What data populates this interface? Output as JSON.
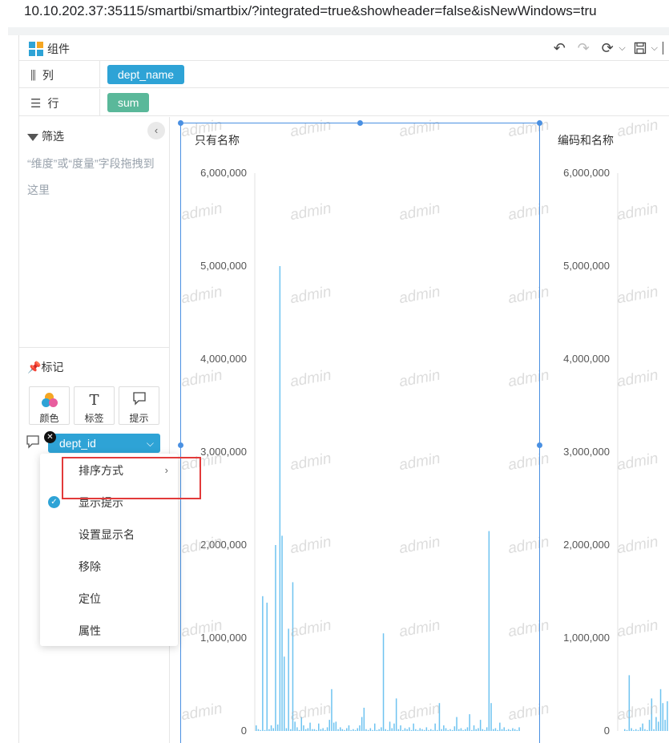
{
  "browser": {
    "url": "10.10.202.37:35115/smartbi/smartbix/?integrated=true&showheader=false&isNewWindows=tru"
  },
  "toolbar": {
    "title": "组件"
  },
  "shelves": {
    "columns": {
      "label": "列",
      "pill": "dept_name"
    },
    "rows": {
      "label": "行",
      "pill": "sum"
    }
  },
  "filter": {
    "title": "筛选",
    "hint": "“维度”或“度量”字段拖拽到这里"
  },
  "marks": {
    "title": "标记",
    "buttons": [
      {
        "label": "颜色",
        "icon": "palette-icon"
      },
      {
        "label": "标签",
        "icon": "text-t-icon",
        "glyph": "T"
      },
      {
        "label": "提示",
        "icon": "tooltip-icon",
        "glyph": "🗨"
      }
    ],
    "field_pill": "dept_id"
  },
  "context_menu": {
    "items": [
      {
        "label": "排序方式",
        "submenu": true,
        "checked": false
      },
      {
        "label": "显示提示",
        "submenu": false,
        "checked": true
      },
      {
        "label": "设置显示名",
        "submenu": false,
        "checked": false
      },
      {
        "label": "移除",
        "submenu": false,
        "checked": false
      },
      {
        "label": "定位",
        "submenu": false,
        "checked": false
      },
      {
        "label": "属性",
        "submenu": false,
        "checked": false
      }
    ]
  },
  "watermark": "admin",
  "colors": {
    "accent": "#2ea3d6",
    "green_pill": "#5ab89a",
    "bar": "#6ec3f0",
    "selection": "#4a90e2",
    "highlight_box": "#e23a3a"
  },
  "chart_data": [
    {
      "type": "bar",
      "title": "只有名称",
      "ylim": [
        0,
        6000000
      ],
      "y_ticks": [
        "6,000,000",
        "5,000,000",
        "4,000,000",
        "3,000,000",
        "2,000,000",
        "1,000,000",
        "0"
      ],
      "values": [
        60000,
        20000,
        10000,
        1450000,
        10000,
        1380000,
        20000,
        60000,
        30000,
        2000000,
        70000,
        5000000,
        2100000,
        800000,
        30000,
        1100000,
        20000,
        1600000,
        100000,
        40000,
        10000,
        150000,
        60000,
        20000,
        30000,
        90000,
        20000,
        20000,
        10000,
        80000,
        20000,
        30000,
        10000,
        40000,
        120000,
        450000,
        90000,
        100000,
        20000,
        40000,
        20000,
        10000,
        30000,
        60000,
        10000,
        20000,
        10000,
        30000,
        60000,
        150000,
        250000,
        20000,
        10000,
        30000,
        10000,
        80000,
        10000,
        20000,
        40000,
        1050000,
        20000,
        10000,
        100000,
        30000,
        80000,
        350000,
        20000,
        60000,
        10000,
        30000,
        20000,
        40000,
        10000,
        80000,
        20000,
        10000,
        30000,
        20000,
        10000,
        40000,
        10000,
        20000,
        10000,
        80000,
        10000,
        300000,
        20000,
        60000,
        30000,
        10000,
        20000,
        10000,
        50000,
        150000,
        20000,
        30000,
        10000,
        20000,
        40000,
        180000,
        10000,
        60000,
        20000,
        30000,
        120000,
        20000,
        10000,
        40000,
        2150000,
        300000,
        20000,
        30000,
        10000,
        90000,
        20000,
        40000,
        10000,
        20000,
        10000,
        30000,
        20000,
        10000,
        40000
      ]
    },
    {
      "type": "bar",
      "title": "编码和名称",
      "ylim": [
        0,
        6000000
      ],
      "y_ticks": [
        "6,000,000",
        "5,000,000",
        "4,000,000",
        "3,000,000",
        "2,000,000",
        "1,000,000",
        "0"
      ],
      "values": [
        20000,
        10000,
        600000,
        30000,
        10000,
        20000,
        10000,
        40000,
        80000,
        20000,
        10000,
        120000,
        350000,
        20000,
        150000,
        100000,
        450000,
        300000,
        120000,
        320000
      ]
    }
  ]
}
